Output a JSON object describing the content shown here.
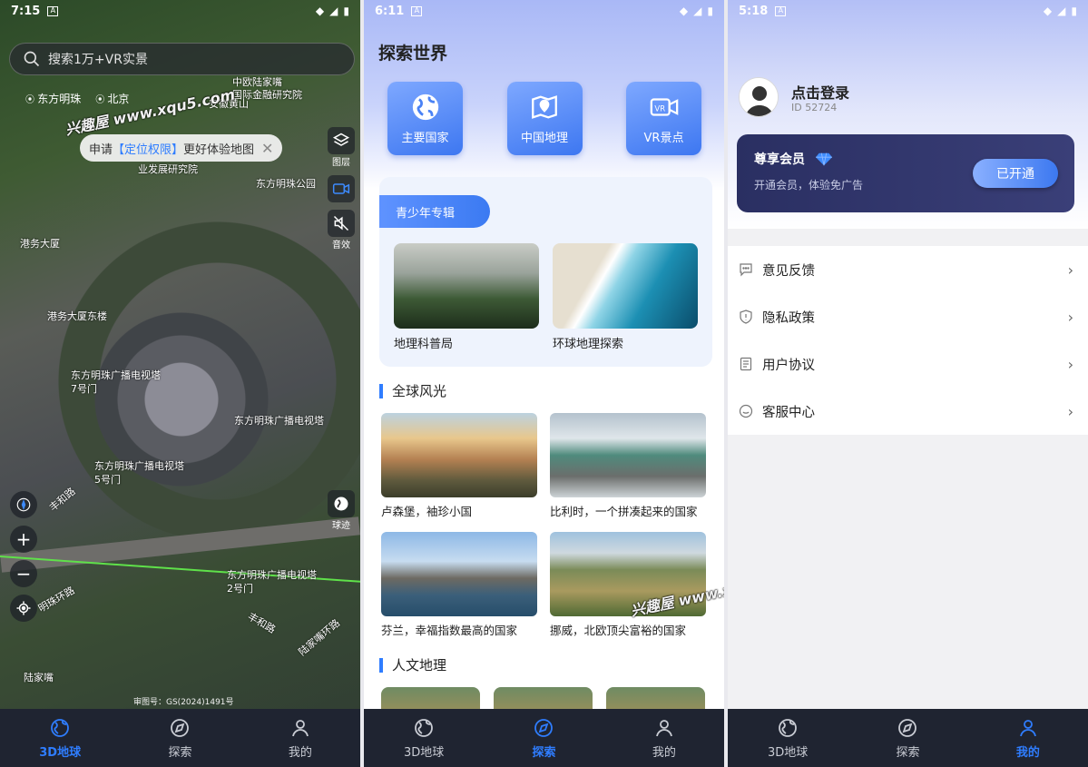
{
  "screen_map": {
    "status": {
      "time": "7:15"
    },
    "search_placeholder": "搜索1万+VR实景",
    "pois": [
      "东方明珠",
      "北京"
    ],
    "toast": {
      "prefix": "申请",
      "highlight": "【定位权限】",
      "suffix": "更好体验地图"
    },
    "side_buttons": [
      {
        "label": "图层",
        "icon": "layers-icon"
      },
      {
        "label": "",
        "icon": "vr-camera-icon"
      },
      {
        "label": "音效",
        "icon": "sound-off-icon"
      }
    ],
    "globe_button": {
      "label": "球迹",
      "icon": "globe-icon"
    },
    "map_labels": [
      "中欧陆家嘴",
      "国际金融研究院",
      "安徽黄山",
      "业发展研究院",
      "东方明珠公园",
      "港务大厦",
      "港务大厦东楼",
      "东方明珠广播电视塔",
      "7号门",
      "东方明珠广播电视塔",
      "东方明珠广播电视塔",
      "5号门",
      "东方明珠广播电视塔",
      "2号门",
      "丰和路",
      "明珠环路",
      "丰和路",
      "陆家嘴环路",
      "陆家嘴"
    ],
    "copyright": "审图号：GS(2024)1491号"
  },
  "screen_explore": {
    "status": {
      "time": "6:11"
    },
    "title": "探索世界",
    "tiles": [
      {
        "label": "主要国家",
        "icon": "globe-icon"
      },
      {
        "label": "中国地理",
        "icon": "china-map-icon"
      },
      {
        "label": "VR景点",
        "icon": "vr-camera-icon"
      }
    ],
    "youth": {
      "tag": "青少年专辑",
      "cards": [
        "地理科普局",
        "环球地理探索"
      ]
    },
    "section_world": "全球风光",
    "world_cards": [
      "卢森堡，袖珍小国",
      "比利时，一个拼凑起来的国家",
      "芬兰，幸福指数最高的国家",
      "挪威，北欧顶尖富裕的国家"
    ],
    "section_humanities": "人文地理"
  },
  "screen_profile": {
    "status": {
      "time": "5:18"
    },
    "login": "点击登录",
    "user_id": "ID 52724",
    "vip": {
      "title": "尊享会员",
      "subtitle": "开通会员，体验免广告",
      "button": "已开通"
    },
    "menu": [
      {
        "label": "意见反馈",
        "icon": "feedback-icon"
      },
      {
        "label": "隐私政策",
        "icon": "shield-icon"
      },
      {
        "label": "用户协议",
        "icon": "document-icon"
      },
      {
        "label": "客服中心",
        "icon": "headset-icon"
      }
    ]
  },
  "bottom_nav": [
    "3D地球",
    "探索",
    "我的"
  ],
  "watermark": "兴趣屋 www.xqu5.com",
  "colors": {
    "accent": "#2f7dff",
    "nav_bg": "#1f2431",
    "vip_bg": "#2a2f62"
  }
}
